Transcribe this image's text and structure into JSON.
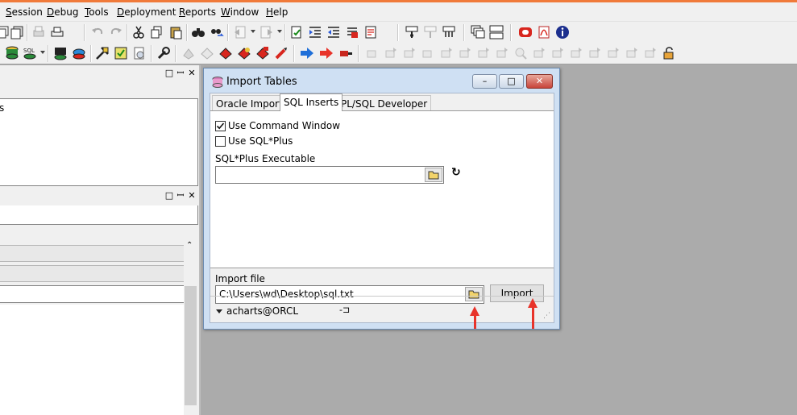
{
  "menu": [
    "Session",
    "Debug",
    "Tools",
    "Deployment",
    "Reports",
    "Window",
    "Help"
  ],
  "colors": {
    "accent_strip": "#f07a3a",
    "annotation_arrow": "#e8332a",
    "dialog_frame": "#cfe0f3"
  },
  "toolbar_row1_icons": [
    "copy-window-icon",
    "print-icon",
    "printer-setup-icon",
    "undo-icon",
    "redo-icon",
    "cut-icon",
    "copy-icon",
    "paste-icon",
    "find-icon",
    "replace-icon",
    "indent-icon",
    "unindent-icon",
    "doc-check-icon",
    "align-icon",
    "align-left-icon",
    "delete-icon",
    "document-icon",
    "beautify-icon",
    "explain-icon",
    "format-icon",
    "cascade-windows-icon",
    "tile-windows-icon",
    "oracle-icon",
    "pdf-icon",
    "info-icon"
  ],
  "toolbar_row2_icons": [
    "database-icon",
    "sql-window-icon",
    "command-window-icon",
    "report-icon",
    "tools-icon",
    "check-icon",
    "export-icon",
    "wrench-icon",
    "compile-icon",
    "eraser-icon",
    "stop-icon",
    "commit-icon",
    "rollback-icon",
    "forward-arrow-icon",
    "back-arrow-icon",
    "disconnect-icon",
    "lock-icon"
  ],
  "dialog": {
    "title": "Import Tables",
    "tabs": [
      "Oracle Import",
      "SQL Inserts",
      "PL/SQL Developer"
    ],
    "active_tab": "SQL Inserts",
    "use_command_window": {
      "label": "Use Command Window",
      "checked": true
    },
    "use_sqlplus": {
      "label": "Use SQL*Plus",
      "checked": false
    },
    "sqlplus_exe_label": "SQL*Plus Executable",
    "sqlplus_exe_value": "",
    "import_file_label": "Import file",
    "import_file_value": "C:\\Users\\wd\\Desktop\\sql.txt",
    "import_button": "Import",
    "connection": "acharts@ORCL"
  },
  "left_pane": {
    "top_text": "s"
  }
}
